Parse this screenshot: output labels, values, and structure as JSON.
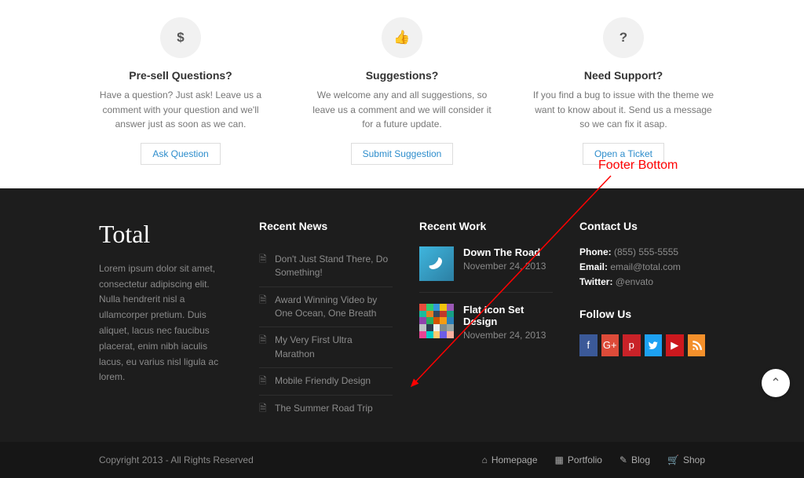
{
  "cards": [
    {
      "icon": "$",
      "title": "Pre-sell Questions?",
      "text": "Have a question? Just ask! Leave us a comment with your question and we'll answer just as soon as we can.",
      "button": "Ask Question"
    },
    {
      "icon": "👍",
      "title": "Suggestions?",
      "text": "We welcome any and all suggestions, so leave us a comment and we will consider it for a future update.",
      "button": "Submit Suggestion"
    },
    {
      "icon": "?",
      "title": "Need Support?",
      "text": "If you find a bug to issue with the theme we want to know about it. Send us a message so we can fix it asap.",
      "button": "Open a Ticket"
    }
  ],
  "footer": {
    "logo": "Total",
    "about": "Lorem ipsum dolor sit amet, consectetur adipiscing elit. Nulla hendrerit nisl a ullamcorper pretium. Duis aliquet, lacus nec faucibus placerat, enim nibh iaculis lacus, eu varius nisl ligula ac lorem.",
    "news_heading": "Recent News",
    "news": [
      "Don't Just Stand There, Do Something!",
      "Award Winning Video by One Ocean, One Breath",
      "My Very First Ultra Marathon",
      "Mobile Friendly Design",
      "The Summer Road Trip"
    ],
    "work_heading": "Recent Work",
    "work": [
      {
        "title": "Down The Road",
        "date": "November 24, 2013"
      },
      {
        "title": "Flat Icon Set Design",
        "date": "November 24, 2013"
      }
    ],
    "contact_heading": "Contact Us",
    "contact": {
      "phone_label": "Phone:",
      "phone": "(855) 555-5555",
      "email_label": "Email:",
      "email": "email@total.com",
      "twitter_label": "Twitter:",
      "twitter": "@envato"
    },
    "follow_heading": "Follow Us"
  },
  "footbar": {
    "copyright": "Copyright 2013 - All Rights Reserved",
    "links": [
      {
        "icon": "⌂",
        "label": "Homepage"
      },
      {
        "icon": "▦",
        "label": "Portfolio"
      },
      {
        "icon": "✎",
        "label": "Blog"
      },
      {
        "icon": "🛒",
        "label": "Shop"
      }
    ]
  },
  "annotation": "Footer Bottom"
}
